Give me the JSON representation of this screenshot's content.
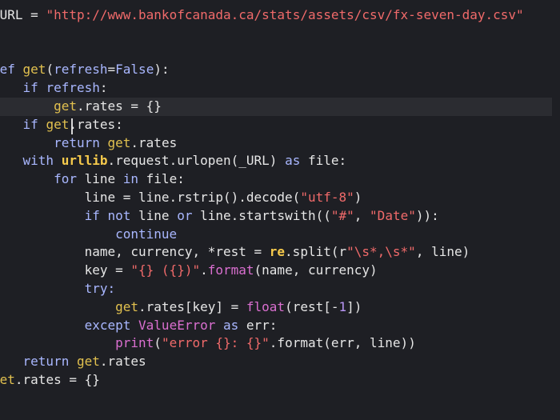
{
  "theme": {
    "background": "#1e1f24",
    "current_line": "#2b2c31",
    "plain": "#e6e6e6",
    "keyword": "#a9b7ff",
    "keyword_alt": "#c678dd",
    "function": "#e2c14f",
    "builtin": "#da6fd0",
    "string": "#f06a6a",
    "number": "#b996f5",
    "module": "#f6ca4c"
  },
  "editor": {
    "current_line_index": 5,
    "lines": [
      [
        {
          "t": "_URL",
          "c": "plain"
        },
        {
          "t": " = ",
          "c": "op"
        },
        {
          "t": "\"http://www.bankofcanada.ca/stats/assets/csv/fx-seven-day.csv\"",
          "c": "str"
        }
      ],
      [],
      [],
      [
        {
          "t": "def ",
          "c": "kw"
        },
        {
          "t": "get",
          "c": "func"
        },
        {
          "t": "(",
          "c": "op"
        },
        {
          "t": "refresh",
          "c": "param"
        },
        {
          "t": "=",
          "c": "op"
        },
        {
          "t": "False",
          "c": "const"
        },
        {
          "t": "):",
          "c": "op"
        }
      ],
      [
        {
          "t": "    if ",
          "c": "kw"
        },
        {
          "t": "refresh",
          "c": "param"
        },
        {
          "t": ":",
          "c": "op"
        }
      ],
      [
        {
          "t": "        ",
          "c": "plain"
        },
        {
          "t": "get",
          "c": "func"
        },
        {
          "t": ".rates = {}",
          "c": "plain"
        }
      ],
      [
        {
          "t": "    if ",
          "c": "kw"
        },
        {
          "t": "get",
          "c": "func"
        },
        {
          "t": ".rates:",
          "c": "plain"
        }
      ],
      [
        {
          "t": "        return ",
          "c": "kw"
        },
        {
          "t": "get",
          "c": "func"
        },
        {
          "t": ".rates",
          "c": "plain"
        }
      ],
      [
        {
          "t": "    with ",
          "c": "kw"
        },
        {
          "t": "urllib",
          "c": "module"
        },
        {
          "t": ".request.urlopen(_URL) ",
          "c": "plain"
        },
        {
          "t": "as ",
          "c": "kw"
        },
        {
          "t": "file:",
          "c": "plain"
        }
      ],
      [
        {
          "t": "        for ",
          "c": "kw"
        },
        {
          "t": "line ",
          "c": "plain"
        },
        {
          "t": "in ",
          "c": "kw"
        },
        {
          "t": "file:",
          "c": "plain"
        }
      ],
      [
        {
          "t": "            line = line.rstrip().decode(",
          "c": "plain"
        },
        {
          "t": "\"utf-8\"",
          "c": "str"
        },
        {
          "t": ")",
          "c": "plain"
        }
      ],
      [
        {
          "t": "            if not ",
          "c": "kw"
        },
        {
          "t": "line ",
          "c": "plain"
        },
        {
          "t": "or ",
          "c": "kw"
        },
        {
          "t": "line.startswith((",
          "c": "plain"
        },
        {
          "t": "\"#\"",
          "c": "str"
        },
        {
          "t": ", ",
          "c": "plain"
        },
        {
          "t": "\"Date\"",
          "c": "str"
        },
        {
          "t": ")):",
          "c": "plain"
        }
      ],
      [
        {
          "t": "                continue",
          "c": "kw"
        }
      ],
      [
        {
          "t": "            name, currency, *rest = ",
          "c": "plain"
        },
        {
          "t": "re",
          "c": "module"
        },
        {
          "t": ".split(r",
          "c": "plain"
        },
        {
          "t": "\"\\s*,\\s*\"",
          "c": "str"
        },
        {
          "t": ", line)",
          "c": "plain"
        }
      ],
      [
        {
          "t": "            key = ",
          "c": "plain"
        },
        {
          "t": "\"{} ({})\"",
          "c": "str"
        },
        {
          "t": ".",
          "c": "plain"
        },
        {
          "t": "format",
          "c": "builtin"
        },
        {
          "t": "(name, currency)",
          "c": "plain"
        }
      ],
      [
        {
          "t": "            try:",
          "c": "kw"
        }
      ],
      [
        {
          "t": "                ",
          "c": "plain"
        },
        {
          "t": "get",
          "c": "func"
        },
        {
          "t": ".rates[key] = ",
          "c": "plain"
        },
        {
          "t": "float",
          "c": "builtin"
        },
        {
          "t": "(rest[-",
          "c": "plain"
        },
        {
          "t": "1",
          "c": "num"
        },
        {
          "t": "])",
          "c": "plain"
        }
      ],
      [
        {
          "t": "            except ",
          "c": "kw"
        },
        {
          "t": "ValueError ",
          "c": "builtin"
        },
        {
          "t": "as ",
          "c": "kw"
        },
        {
          "t": "err:",
          "c": "plain"
        }
      ],
      [
        {
          "t": "                ",
          "c": "plain"
        },
        {
          "t": "print",
          "c": "builtin"
        },
        {
          "t": "(",
          "c": "plain"
        },
        {
          "t": "\"error {}: {}\"",
          "c": "str"
        },
        {
          "t": ".format(err, line))",
          "c": "plain"
        }
      ],
      [
        {
          "t": "    return ",
          "c": "kw"
        },
        {
          "t": "get",
          "c": "func"
        },
        {
          "t": ".rates",
          "c": "plain"
        }
      ],
      [
        {
          "t": "get",
          "c": "func"
        },
        {
          "t": ".rates = {}",
          "c": "plain"
        }
      ]
    ]
  }
}
